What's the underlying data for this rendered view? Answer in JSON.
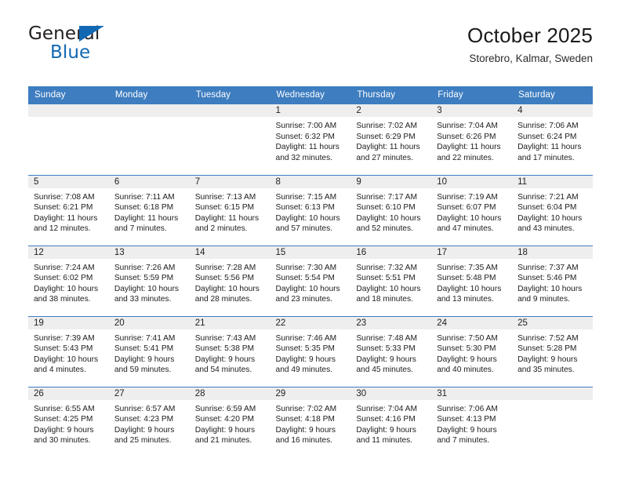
{
  "logo": {
    "word1": "General",
    "word2": "Blue",
    "triangle_color": "#1268b3"
  },
  "header": {
    "title": "October 2025",
    "subtitle": "Storebro, Kalmar, Sweden",
    "accent_color": "#3d7dc0"
  },
  "weekday_headers": [
    "Sunday",
    "Monday",
    "Tuesday",
    "Wednesday",
    "Thursday",
    "Friday",
    "Saturday"
  ],
  "labels": {
    "sunrise": "Sunrise:",
    "sunset": "Sunset:",
    "daylight": "Daylight:"
  },
  "weeks": [
    [
      {
        "day": "",
        "empty": true
      },
      {
        "day": "",
        "empty": true
      },
      {
        "day": "",
        "empty": true
      },
      {
        "day": "1",
        "sunrise": "Sunrise: 7:00 AM",
        "sunset": "Sunset: 6:32 PM",
        "daylight1": "Daylight: 11 hours",
        "daylight2": "and 32 minutes."
      },
      {
        "day": "2",
        "sunrise": "Sunrise: 7:02 AM",
        "sunset": "Sunset: 6:29 PM",
        "daylight1": "Daylight: 11 hours",
        "daylight2": "and 27 minutes."
      },
      {
        "day": "3",
        "sunrise": "Sunrise: 7:04 AM",
        "sunset": "Sunset: 6:26 PM",
        "daylight1": "Daylight: 11 hours",
        "daylight2": "and 22 minutes."
      },
      {
        "day": "4",
        "sunrise": "Sunrise: 7:06 AM",
        "sunset": "Sunset: 6:24 PM",
        "daylight1": "Daylight: 11 hours",
        "daylight2": "and 17 minutes."
      }
    ],
    [
      {
        "day": "5",
        "sunrise": "Sunrise: 7:08 AM",
        "sunset": "Sunset: 6:21 PM",
        "daylight1": "Daylight: 11 hours",
        "daylight2": "and 12 minutes."
      },
      {
        "day": "6",
        "sunrise": "Sunrise: 7:11 AM",
        "sunset": "Sunset: 6:18 PM",
        "daylight1": "Daylight: 11 hours",
        "daylight2": "and 7 minutes."
      },
      {
        "day": "7",
        "sunrise": "Sunrise: 7:13 AM",
        "sunset": "Sunset: 6:15 PM",
        "daylight1": "Daylight: 11 hours",
        "daylight2": "and 2 minutes."
      },
      {
        "day": "8",
        "sunrise": "Sunrise: 7:15 AM",
        "sunset": "Sunset: 6:13 PM",
        "daylight1": "Daylight: 10 hours",
        "daylight2": "and 57 minutes."
      },
      {
        "day": "9",
        "sunrise": "Sunrise: 7:17 AM",
        "sunset": "Sunset: 6:10 PM",
        "daylight1": "Daylight: 10 hours",
        "daylight2": "and 52 minutes."
      },
      {
        "day": "10",
        "sunrise": "Sunrise: 7:19 AM",
        "sunset": "Sunset: 6:07 PM",
        "daylight1": "Daylight: 10 hours",
        "daylight2": "and 47 minutes."
      },
      {
        "day": "11",
        "sunrise": "Sunrise: 7:21 AM",
        "sunset": "Sunset: 6:04 PM",
        "daylight1": "Daylight: 10 hours",
        "daylight2": "and 43 minutes."
      }
    ],
    [
      {
        "day": "12",
        "sunrise": "Sunrise: 7:24 AM",
        "sunset": "Sunset: 6:02 PM",
        "daylight1": "Daylight: 10 hours",
        "daylight2": "and 38 minutes."
      },
      {
        "day": "13",
        "sunrise": "Sunrise: 7:26 AM",
        "sunset": "Sunset: 5:59 PM",
        "daylight1": "Daylight: 10 hours",
        "daylight2": "and 33 minutes."
      },
      {
        "day": "14",
        "sunrise": "Sunrise: 7:28 AM",
        "sunset": "Sunset: 5:56 PM",
        "daylight1": "Daylight: 10 hours",
        "daylight2": "and 28 minutes."
      },
      {
        "day": "15",
        "sunrise": "Sunrise: 7:30 AM",
        "sunset": "Sunset: 5:54 PM",
        "daylight1": "Daylight: 10 hours",
        "daylight2": "and 23 minutes."
      },
      {
        "day": "16",
        "sunrise": "Sunrise: 7:32 AM",
        "sunset": "Sunset: 5:51 PM",
        "daylight1": "Daylight: 10 hours",
        "daylight2": "and 18 minutes."
      },
      {
        "day": "17",
        "sunrise": "Sunrise: 7:35 AM",
        "sunset": "Sunset: 5:48 PM",
        "daylight1": "Daylight: 10 hours",
        "daylight2": "and 13 minutes."
      },
      {
        "day": "18",
        "sunrise": "Sunrise: 7:37 AM",
        "sunset": "Sunset: 5:46 PM",
        "daylight1": "Daylight: 10 hours",
        "daylight2": "and 9 minutes."
      }
    ],
    [
      {
        "day": "19",
        "sunrise": "Sunrise: 7:39 AM",
        "sunset": "Sunset: 5:43 PM",
        "daylight1": "Daylight: 10 hours",
        "daylight2": "and 4 minutes."
      },
      {
        "day": "20",
        "sunrise": "Sunrise: 7:41 AM",
        "sunset": "Sunset: 5:41 PM",
        "daylight1": "Daylight: 9 hours",
        "daylight2": "and 59 minutes."
      },
      {
        "day": "21",
        "sunrise": "Sunrise: 7:43 AM",
        "sunset": "Sunset: 5:38 PM",
        "daylight1": "Daylight: 9 hours",
        "daylight2": "and 54 minutes."
      },
      {
        "day": "22",
        "sunrise": "Sunrise: 7:46 AM",
        "sunset": "Sunset: 5:35 PM",
        "daylight1": "Daylight: 9 hours",
        "daylight2": "and 49 minutes."
      },
      {
        "day": "23",
        "sunrise": "Sunrise: 7:48 AM",
        "sunset": "Sunset: 5:33 PM",
        "daylight1": "Daylight: 9 hours",
        "daylight2": "and 45 minutes."
      },
      {
        "day": "24",
        "sunrise": "Sunrise: 7:50 AM",
        "sunset": "Sunset: 5:30 PM",
        "daylight1": "Daylight: 9 hours",
        "daylight2": "and 40 minutes."
      },
      {
        "day": "25",
        "sunrise": "Sunrise: 7:52 AM",
        "sunset": "Sunset: 5:28 PM",
        "daylight1": "Daylight: 9 hours",
        "daylight2": "and 35 minutes."
      }
    ],
    [
      {
        "day": "26",
        "sunrise": "Sunrise: 6:55 AM",
        "sunset": "Sunset: 4:25 PM",
        "daylight1": "Daylight: 9 hours",
        "daylight2": "and 30 minutes."
      },
      {
        "day": "27",
        "sunrise": "Sunrise: 6:57 AM",
        "sunset": "Sunset: 4:23 PM",
        "daylight1": "Daylight: 9 hours",
        "daylight2": "and 25 minutes."
      },
      {
        "day": "28",
        "sunrise": "Sunrise: 6:59 AM",
        "sunset": "Sunset: 4:20 PM",
        "daylight1": "Daylight: 9 hours",
        "daylight2": "and 21 minutes."
      },
      {
        "day": "29",
        "sunrise": "Sunrise: 7:02 AM",
        "sunset": "Sunset: 4:18 PM",
        "daylight1": "Daylight: 9 hours",
        "daylight2": "and 16 minutes."
      },
      {
        "day": "30",
        "sunrise": "Sunrise: 7:04 AM",
        "sunset": "Sunset: 4:16 PM",
        "daylight1": "Daylight: 9 hours",
        "daylight2": "and 11 minutes."
      },
      {
        "day": "31",
        "sunrise": "Sunrise: 7:06 AM",
        "sunset": "Sunset: 4:13 PM",
        "daylight1": "Daylight: 9 hours",
        "daylight2": "and 7 minutes."
      },
      {
        "day": "",
        "empty": true
      }
    ]
  ]
}
